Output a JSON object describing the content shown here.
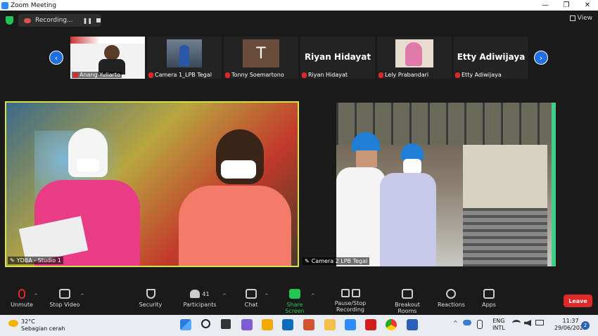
{
  "window": {
    "title": "Zoom Meeting",
    "minimize": "—",
    "maximize": "❐",
    "close": "✕"
  },
  "topbar": {
    "recording_label": "Recording...",
    "pause_glyph": "❚❚",
    "view_label": "View"
  },
  "participants_strip": [
    {
      "name": "Anang Yuliarto"
    },
    {
      "name": "Camera 1_LPB Tegal"
    },
    {
      "name": "Tonny Soemartono",
      "letter": "T"
    },
    {
      "name": "Riyan Hidayat",
      "display": "Riyan Hidayat"
    },
    {
      "name": "Lely Prabandari"
    },
    {
      "name": "Etty Adiwijaya",
      "display": "Etty Adiwijaya"
    }
  ],
  "arrows": {
    "left": "‹",
    "right": "›"
  },
  "videos": {
    "main_left_label": "YDBA - Studio 1",
    "main_right_label": "Camera 2 LPB Tegal"
  },
  "toolbar": {
    "unmute": "Unmute",
    "stop_video": "Stop Video",
    "security": "Security",
    "participants": "Participants",
    "participants_count": "41",
    "chat": "Chat",
    "share_screen": "Share Screen",
    "pause_stop_recording": "Pause/Stop Recording",
    "breakout_rooms": "Breakout Rooms",
    "reactions": "Reactions",
    "apps": "Apps",
    "leave": "Leave",
    "caret": "^"
  },
  "taskbar": {
    "weather_temp": "32°C",
    "weather_desc": "Sebagian cerah",
    "lang_top": "ENG",
    "lang_bottom": "INTL",
    "time": "11:37",
    "date": "29/06/2022",
    "notifications": "2",
    "tray_caret": "^"
  },
  "colors": {
    "accent": "#2d8cff",
    "leave": "#e02828",
    "share": "#23c552",
    "speaker_border": "#d6e04a"
  }
}
